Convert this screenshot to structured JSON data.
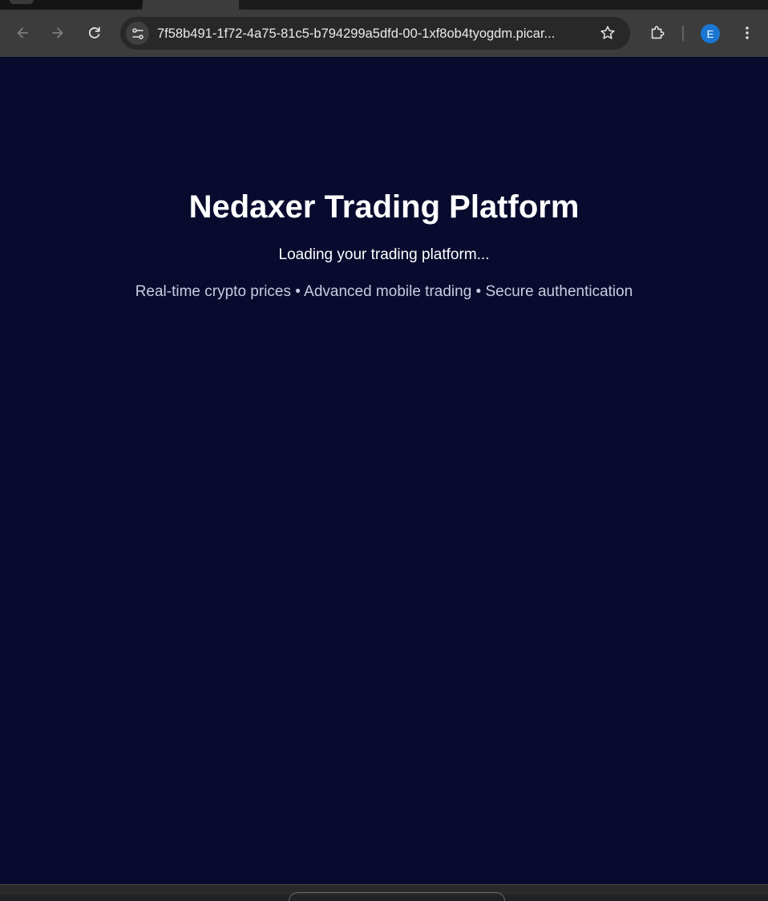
{
  "browser": {
    "url": "7f58b491-1f72-4a75-81c5-b794299a5dfd-00-1xf8ob4tyogdm.picar...",
    "profile_initial": "E",
    "colors": {
      "toolbar": "#3c3c3c",
      "omnibox": "#282828",
      "avatar": "#1976d2"
    },
    "icons": {
      "back": "arrow-left-icon",
      "forward": "arrow-right-icon",
      "reload": "reload-icon",
      "site_info": "tune-icon",
      "bookmark": "star-icon",
      "extensions": "puzzle-icon",
      "menu": "kebab-menu-icon"
    }
  },
  "page": {
    "title": "Nedaxer Trading Platform",
    "loading": "Loading your trading platform...",
    "features": "Real-time crypto prices • Advanced mobile trading • Secure authentication",
    "colors": {
      "background": "#080a2e",
      "title": "#ffffff",
      "features": "#c9cbe0"
    }
  }
}
